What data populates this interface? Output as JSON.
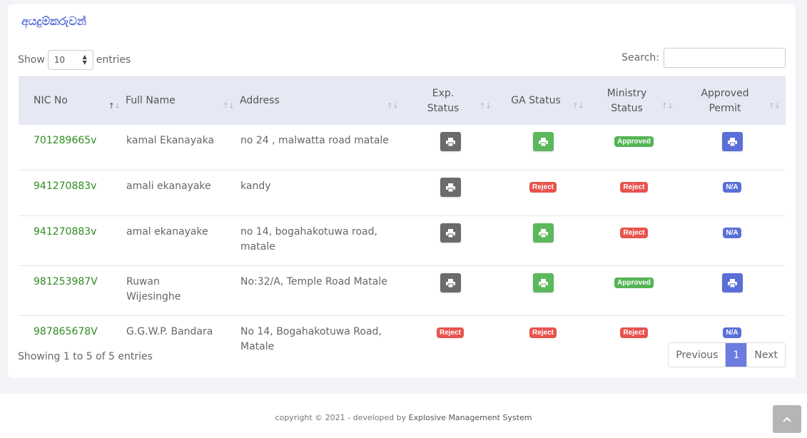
{
  "card_title": "අයදුම්කරුවන්",
  "length": {
    "show_label": "Show",
    "value": "10",
    "entries_label": "entries"
  },
  "search": {
    "label": "Search:",
    "value": ""
  },
  "table": {
    "headers": {
      "nic": "NIC No",
      "name": "Full Name",
      "address": "Address",
      "exp_1": "Exp.",
      "exp_2": "Status",
      "ga": "GA Status",
      "min_1": "Ministry",
      "min_2": "Status",
      "ap_1": "Approved",
      "ap_2": "Permit"
    },
    "rows": [
      {
        "nic": "701289665v",
        "name": "kamal Ekanayaka",
        "address": "no 24 , malwatta road matale"
      },
      {
        "nic": "941270883v",
        "name": "amali ekanayake",
        "address": "kandy"
      },
      {
        "nic": "941270883v",
        "name": "amal ekanayake",
        "address_1": "no 14, bogahakotuwa road,",
        "address_2": "matale"
      },
      {
        "nic": "981253987V",
        "name_1": "Ruwan",
        "name_2": "Wijesinghe",
        "address": "No:32/A, Temple Road Matale"
      },
      {
        "nic": "987865678V",
        "name": "G.G.W.P. Bandara",
        "address_1": "No 14, Bogahakotuwa Road,",
        "address_2": "Matale"
      }
    ],
    "badges": {
      "reject": "Reject",
      "approved": "Approved",
      "na": "N/A"
    }
  },
  "info": "Showing 1 to 5 of 5 entries",
  "pager": {
    "prev": "Previous",
    "current": "1",
    "next": "Next"
  },
  "footer": {
    "prefix": "copyright © 2021 - developed by ",
    "brand": "Explosive Management System"
  },
  "colors": {
    "accent": "#5a6fd8",
    "nic_green": "#2e8b1e",
    "reject": "#e8534e",
    "approved": "#54b454"
  },
  "icons": {
    "print": "print-icon",
    "scroll_top": "chevron-up-icon",
    "sort": "sort-arrows-icon"
  }
}
